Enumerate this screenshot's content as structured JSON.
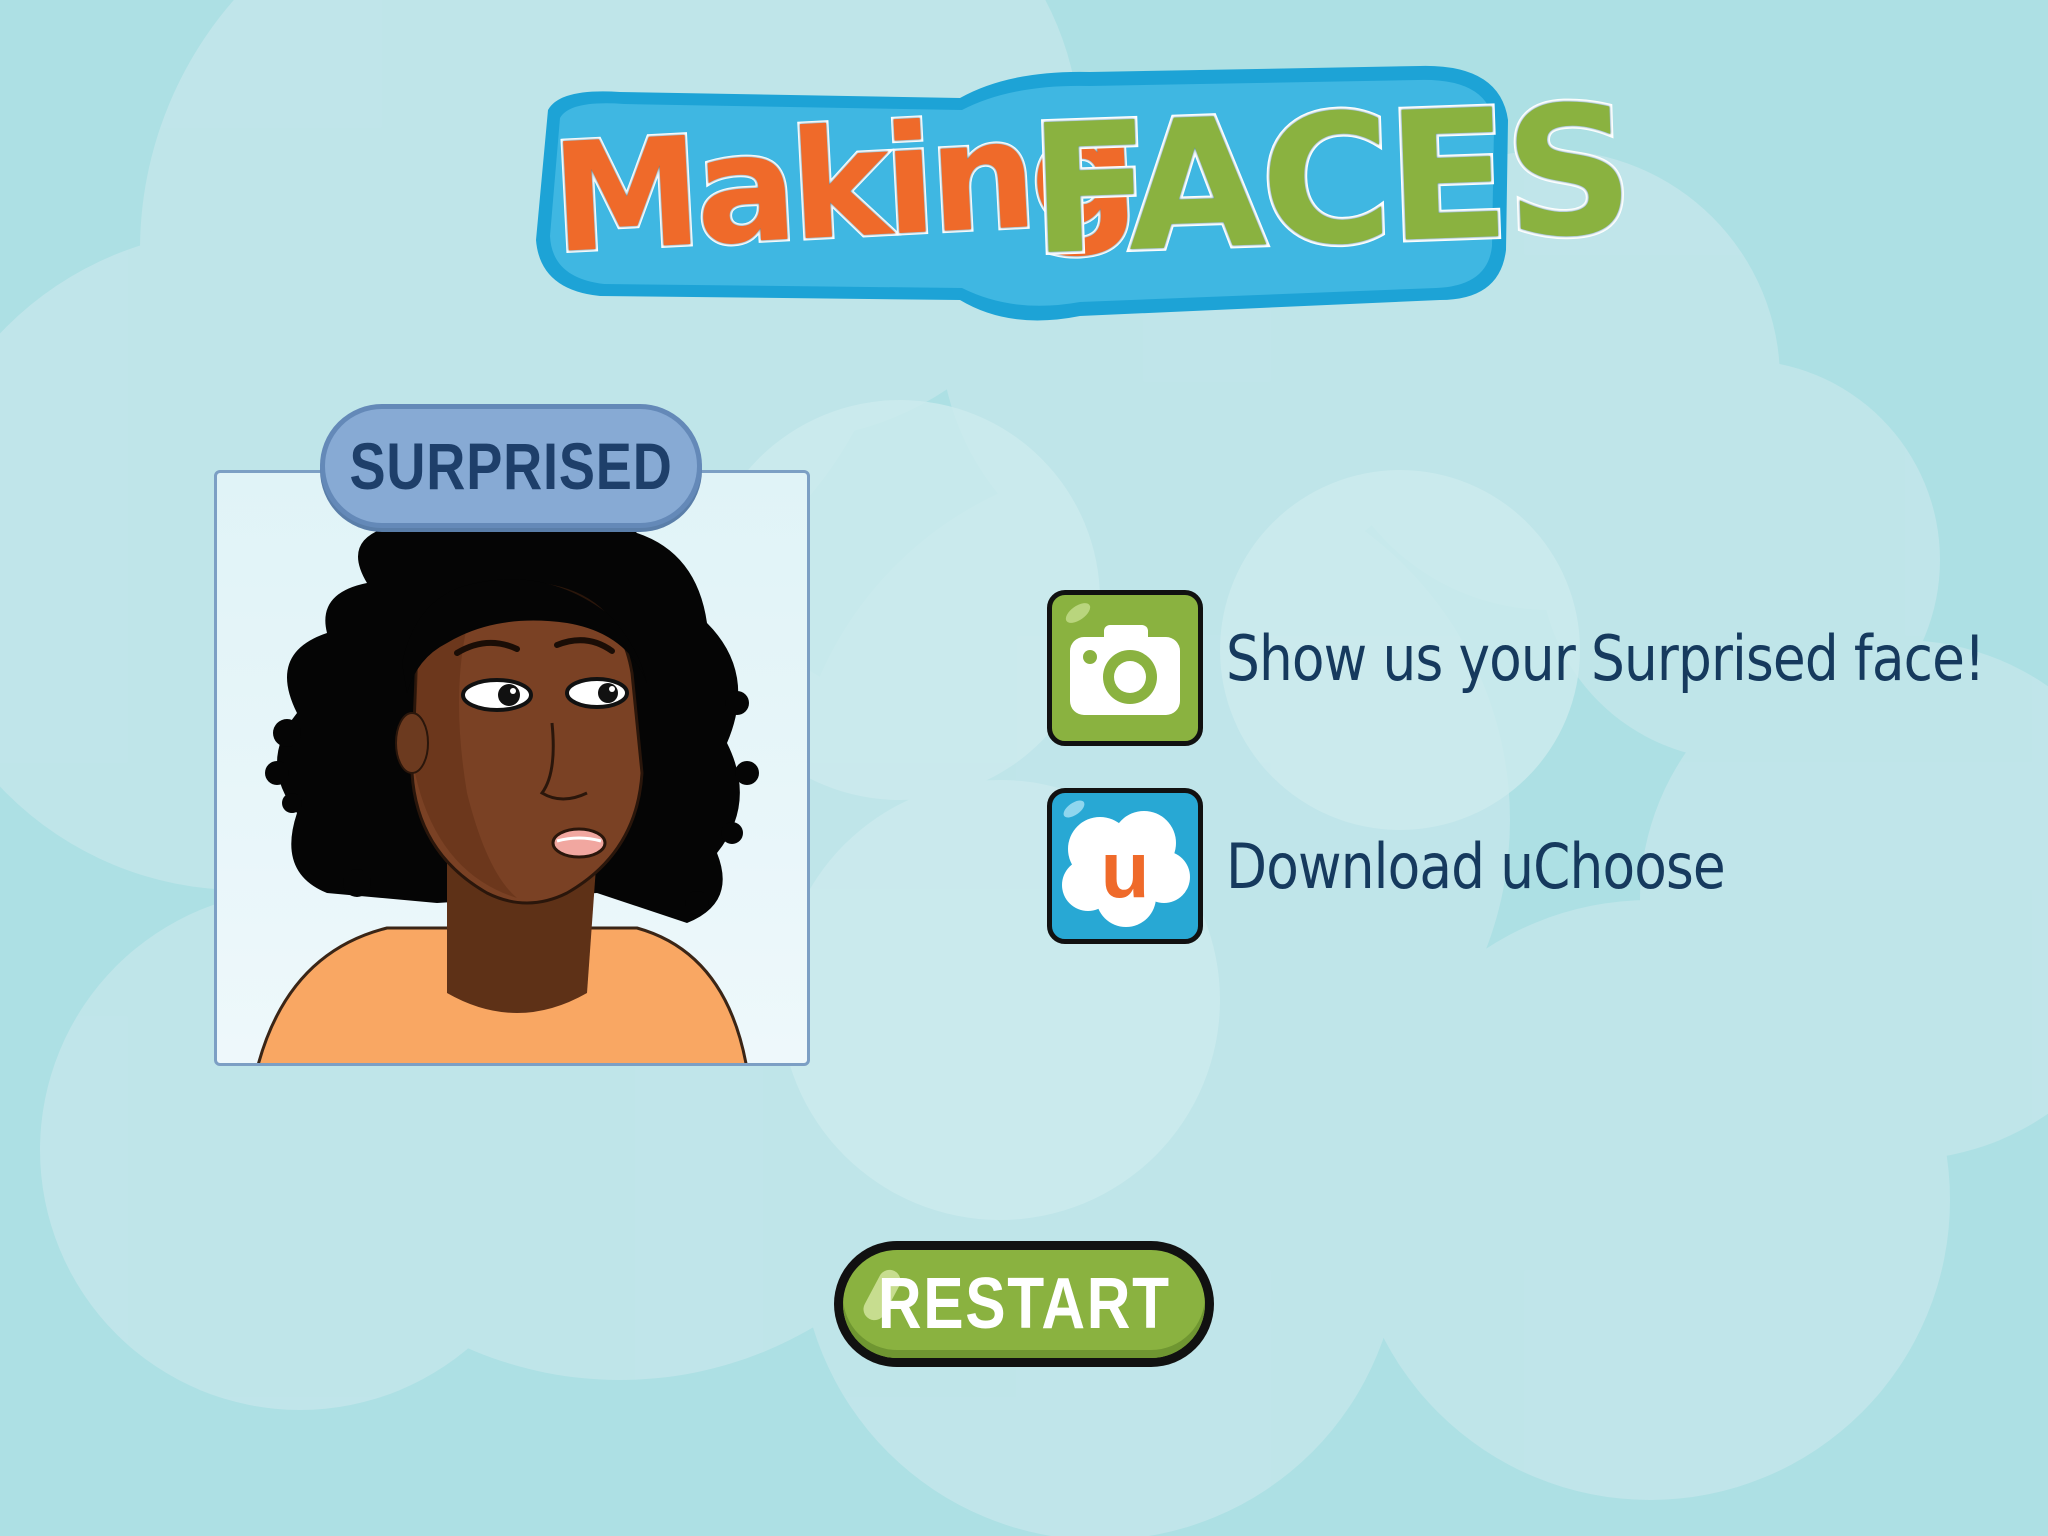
{
  "logo": {
    "word1": "Making",
    "word2": "FACES"
  },
  "card": {
    "emotion_label": "SURPRISED",
    "character": "cartoon-woman-surprised"
  },
  "actions": {
    "camera": {
      "icon": "camera-icon",
      "label": "Show us your Surprised face!"
    },
    "uchoose": {
      "icon": "uchoose-app-icon",
      "icon_letter": "u",
      "label": "Download uChoose"
    }
  },
  "restart": {
    "label": "RESTART"
  },
  "colors": {
    "background": "#ade0e4",
    "accent_green": "#8ab240",
    "accent_orange": "#ef6a2a",
    "accent_blue": "#28a8d4",
    "text_navy": "#163a5e"
  }
}
